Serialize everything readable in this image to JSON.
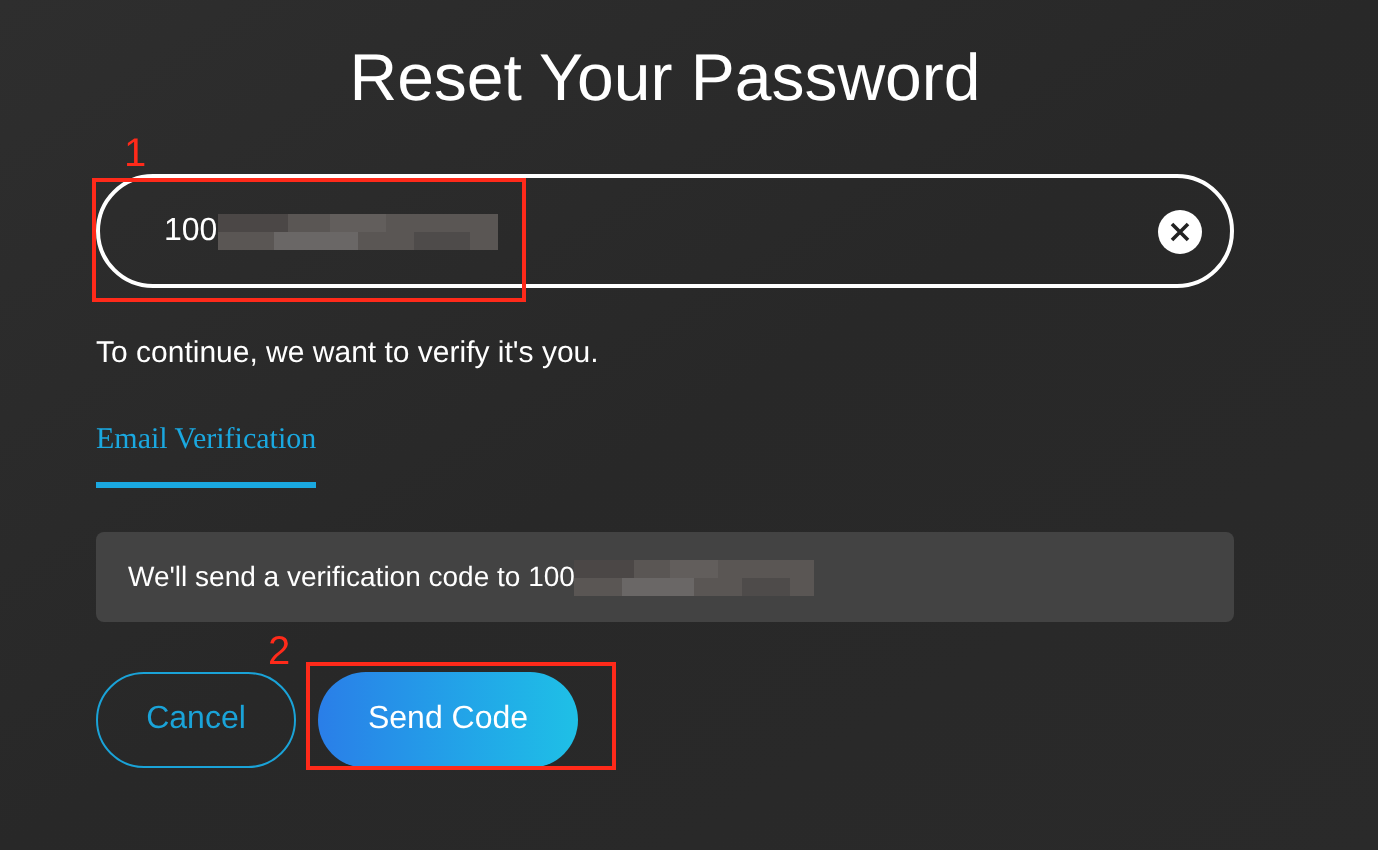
{
  "title": "Reset Your Password",
  "account_field": {
    "value": "100",
    "redacted": true
  },
  "prompt": "To continue, we want to verify it's you.",
  "tabs": [
    {
      "label": "Email Verification",
      "selected": true
    }
  ],
  "info": {
    "text": "We'll send a verification code to 100",
    "redacted": true
  },
  "buttons": [
    {
      "label": "Cancel",
      "kind": "outline"
    },
    {
      "label": "Send Code",
      "kind": "primary"
    }
  ],
  "annotations": [
    {
      "label": "1"
    },
    {
      "label": "2"
    }
  ]
}
